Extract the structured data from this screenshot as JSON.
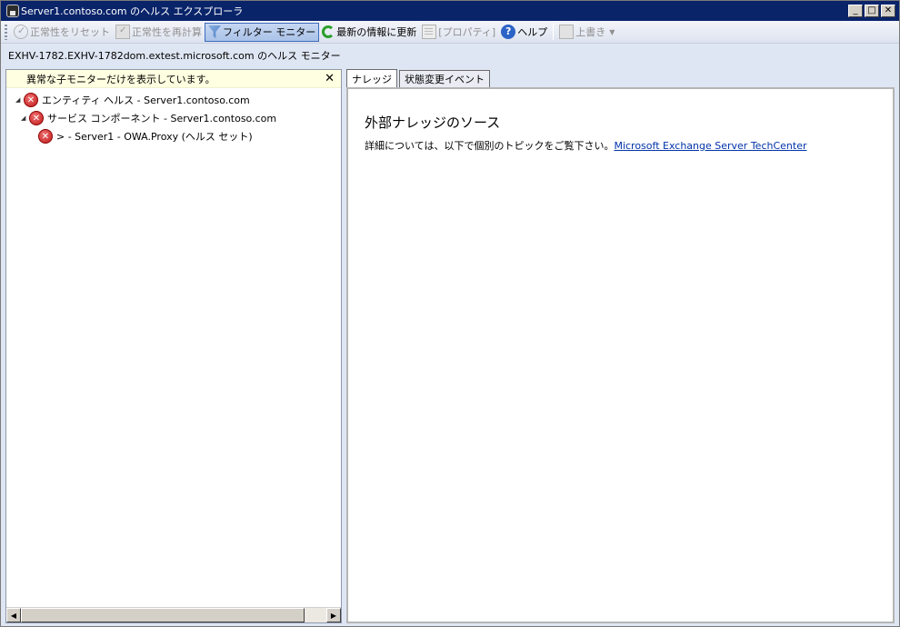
{
  "window": {
    "title": "Server1.contoso.com のヘルス エクスプローラ",
    "controls": {
      "minimize": "_",
      "maximize": "□",
      "close": "✕"
    }
  },
  "toolbar": {
    "reset_health": "正常性をリセット",
    "recalculate_health": "正常性を再計算",
    "filter_monitors": "フィルター モニター",
    "refresh": "最新の情報に更新",
    "properties": "[プロパティ]",
    "help": "ヘルプ",
    "override": "上書き",
    "help_icon_glyph": "?",
    "dropdown_glyph": "▼"
  },
  "subheader": {
    "text": "EXHV-1782.EXHV-1782dom.extest.microsoft.com のヘルス モニター"
  },
  "left_pane": {
    "filter_notice": "異常な子モニターだけを表示しています。",
    "filter_close": "✕",
    "tree": [
      {
        "expander": "◢",
        "icon": "error-icon",
        "label": "エンティティ ヘルス - Server1.contoso.com"
      },
      {
        "expander": "◢",
        "icon": "error-icon",
        "label": "サービス コンポーネント - Server1.contoso.com"
      },
      {
        "expander": "",
        "icon": "error-icon",
        "label": "> - Server1 - OWA.Proxy (ヘルス セット)"
      }
    ],
    "error_glyph": "✕",
    "scroll_left": "◀",
    "scroll_right": "▶"
  },
  "tabs": [
    {
      "label": "ナレッジ",
      "selected": true
    },
    {
      "label": "状態変更イベント",
      "selected": false
    }
  ],
  "knowledge": {
    "title": "外部ナレッジのソース",
    "body": "詳細については、以下で個別のトピックをご覧下さい。",
    "link_text": "Microsoft Exchange Server TechCenter"
  },
  "colors": {
    "title_bar": "#0a246a",
    "filter_bar": "#ffffe1",
    "error": "#c01a1a",
    "link": "#0033aa"
  }
}
